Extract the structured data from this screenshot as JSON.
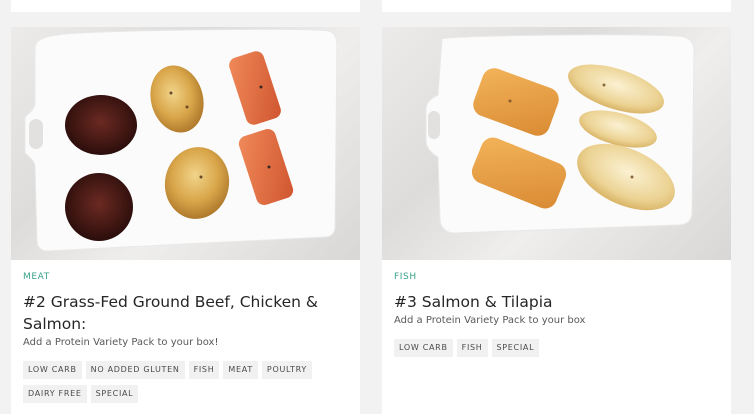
{
  "cards": [
    {
      "category": "MEAT",
      "title": "#2 Grass-Fed Ground Beef, Chicken & Salmon:",
      "subtitle": "Add a Protein Variety Pack to your box!",
      "tags": [
        "LOW CARB",
        "NO ADDED GLUTEN",
        "FISH",
        "MEAT",
        "POULTRY",
        "DAIRY FREE",
        "SPECIAL"
      ]
    },
    {
      "category": "FISH",
      "title": "#3 Salmon & Tilapia",
      "subtitle": "Add a Protein Variety Pack to your box",
      "tags": [
        "LOW CARB",
        "FISH",
        "SPECIAL"
      ]
    }
  ],
  "colors": {
    "category": "#3aa38a",
    "title": "#262626",
    "tag_bg": "#f1f1f1",
    "page_bg": "#f2f2f2"
  }
}
